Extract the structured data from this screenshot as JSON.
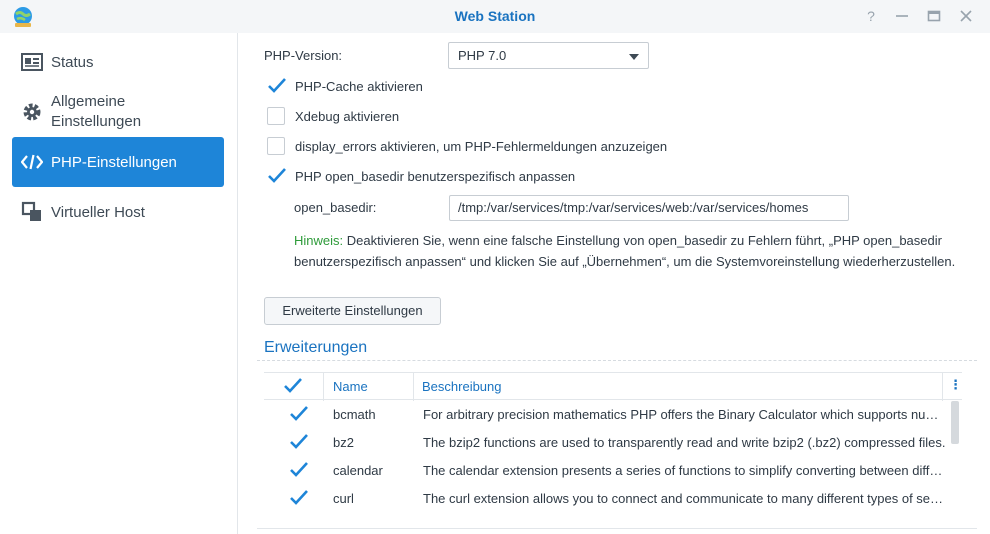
{
  "window": {
    "title": "Web Station",
    "controls": {
      "help": "?",
      "minimize": "—",
      "maximize": "▭",
      "close": "✕"
    }
  },
  "sidebar": {
    "items": [
      {
        "label": "Status",
        "icon": "id-card-icon",
        "active": false
      },
      {
        "label": "Allgemeine Einstellungen",
        "line1": "Allgemeine",
        "line2": "Einstellungen",
        "icon": "gear-icon",
        "active": false
      },
      {
        "label": "PHP-Einstellungen",
        "icon": "code-icon",
        "active": true
      },
      {
        "label": "Virtueller Host",
        "icon": "virtual-host-icon",
        "active": false
      }
    ]
  },
  "php": {
    "version_label": "PHP-Version:",
    "version_value": "PHP 7.0",
    "options": [
      {
        "label": "PHP-Cache aktivieren",
        "checked": true
      },
      {
        "label": "Xdebug aktivieren",
        "checked": false
      },
      {
        "label": "display_errors aktivieren, um PHP-Fehlermeldungen anzuzeigen",
        "checked": false
      },
      {
        "label": "PHP open_basedir benutzerspezifisch anpassen",
        "checked": true
      }
    ],
    "open_basedir_label": "open_basedir:",
    "open_basedir_value": "/tmp:/var/services/tmp:/var/services/web:/var/services/homes",
    "hint_prefix": "Hinweis:",
    "hint_text": " Deaktivieren Sie, wenn eine falsche Einstellung von open_basedir zu Fehlern führt, „PHP open_basedir benutzerspezifisch anpassen“ und klicken Sie auf „Übernehmen“, um die Systemvoreinstellung wiederherzustellen.",
    "advanced_button": "Erweiterte Einstellungen"
  },
  "extensions": {
    "title": "Erweiterungen",
    "columns": {
      "name": "Name",
      "description": "Beschreibung"
    },
    "rows": [
      {
        "name": "bcmath",
        "description": "For arbitrary precision mathematics PHP offers the Binary Calculator which supports numbers of any size and precision",
        "checked": true
      },
      {
        "name": "bz2",
        "description": "The bzip2 functions are used to transparently read and write bzip2 (.bz2) compressed files.",
        "checked": true
      },
      {
        "name": "calendar",
        "description": "The calendar extension presents a series of functions to simplify converting between different calendar formats.",
        "checked": true
      },
      {
        "name": "curl",
        "description": "The curl extension allows you to connect and communicate to many different types of servers with many different types of protocols.",
        "checked": true
      }
    ]
  },
  "colors": {
    "accent": "#1e85d8",
    "link": "#1a73c0",
    "hint": "#2e9b3a"
  }
}
